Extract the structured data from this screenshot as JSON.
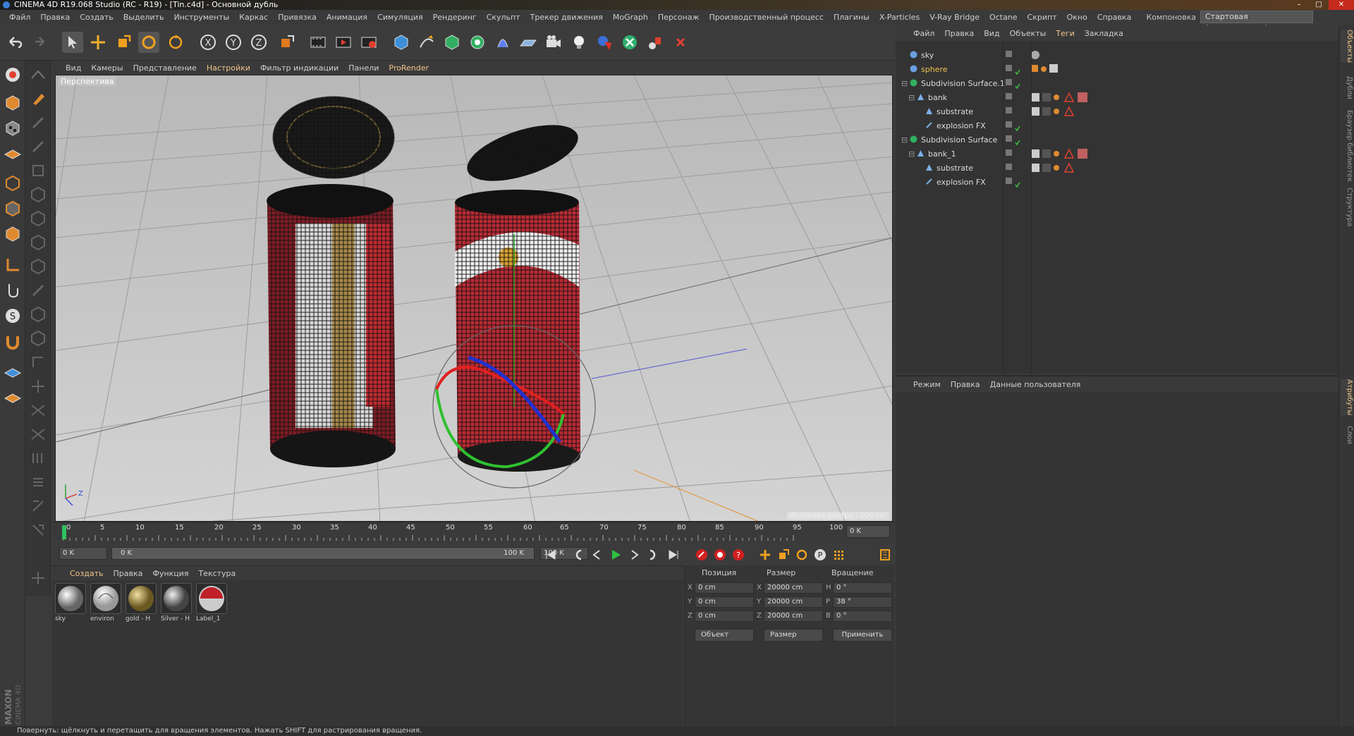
{
  "window": {
    "title": "CINEMA 4D R19.068 Studio (RC - R19) - [Tin.c4d] - Основной дубль",
    "minimize": "–",
    "maximize": "□",
    "close": "✕"
  },
  "menubar": {
    "items": [
      "Файл",
      "Правка",
      "Создать",
      "Выделить",
      "Инструменты",
      "Каркас",
      "Привязка",
      "Анимация",
      "Симуляция",
      "Рендеринг",
      "Скульпт",
      "Трекер движения",
      "MoGraph",
      "Персонаж",
      "Производственный процесс",
      "Плагины",
      "X-Particles",
      "V-Ray Bridge",
      "Octane",
      "Скрипт",
      "Окно",
      "Справка"
    ],
    "layout_label": "Компоновка",
    "layout_value": "Стартовая (пользователь)"
  },
  "viewport": {
    "menu": [
      "Вид",
      "Камеры",
      "Представление",
      "Настройки",
      "Фильтр индикации",
      "Панели",
      "ProRender"
    ],
    "label": "Перспектива",
    "grid_info": "Интервал растра : 100 cm"
  },
  "timeline": {
    "ticks": [
      "0",
      "5",
      "10",
      "15",
      "20",
      "25",
      "30",
      "35",
      "40",
      "45",
      "50",
      "55",
      "60",
      "65",
      "70",
      "75",
      "80",
      "85",
      "90",
      "95",
      "100"
    ],
    "current_frame": "0 K",
    "start": "0 K",
    "range_start": "0 K",
    "range_end": "100 K",
    "end": "100 K"
  },
  "materials": {
    "menu": [
      "Создать",
      "Правка",
      "Функция",
      "Текстура"
    ],
    "items": [
      {
        "name": "sky"
      },
      {
        "name": "environ"
      },
      {
        "name": "gold - H"
      },
      {
        "name": "Silver - H"
      },
      {
        "name": "Label_1"
      }
    ]
  },
  "coords": {
    "headers": [
      "Позиция",
      "Размер",
      "Вращение"
    ],
    "rows": [
      {
        "axis": "X",
        "pos": "0 cm",
        "size_axis": "X",
        "size": "20000 cm",
        "rot_axis": "H",
        "rot": "0 °"
      },
      {
        "axis": "Y",
        "pos": "0 cm",
        "size_axis": "Y",
        "size": "20000 cm",
        "rot_axis": "P",
        "rot": "38 °"
      },
      {
        "axis": "Z",
        "pos": "0 cm",
        "size_axis": "Z",
        "size": "20000 cm",
        "rot_axis": "B",
        "rot": "0 °"
      }
    ],
    "mode_object": "Объект",
    "mode_size": "Размер",
    "apply": "Применить"
  },
  "objects": {
    "menu": [
      "Файл",
      "Правка",
      "Вид",
      "Объекты",
      "Теги",
      "Закладка"
    ],
    "tree": [
      {
        "name": "sky",
        "color": "#cccccc"
      },
      {
        "name": "sphere",
        "color": "#f0c050"
      },
      {
        "name": "Subdivision Surface.1",
        "color": "#cccccc"
      },
      {
        "name": "bank",
        "color": "#cccccc"
      },
      {
        "name": "substrate",
        "color": "#cccccc"
      },
      {
        "name": "explosion FX",
        "color": "#cccccc"
      },
      {
        "name": "Subdivision Surface",
        "color": "#cccccc"
      },
      {
        "name": "bank_1",
        "color": "#cccccc"
      },
      {
        "name": "substrate",
        "color": "#cccccc"
      },
      {
        "name": "explosion FX",
        "color": "#cccccc"
      }
    ]
  },
  "attributes": {
    "menu": [
      "Режим",
      "Правка",
      "Данные пользователя"
    ]
  },
  "right_tabs": [
    "Объекты",
    "Дубли",
    "Браузер библиотек",
    "Структура",
    "Атрибуты",
    "Слои"
  ],
  "statusbar": "Повернуть: щёлкнуть и перетащить для вращения элементов. Нажать SHIFT для растрирования вращения.",
  "brand": {
    "maxon": "MAXON",
    "cinema": "CINEMA 4D"
  }
}
